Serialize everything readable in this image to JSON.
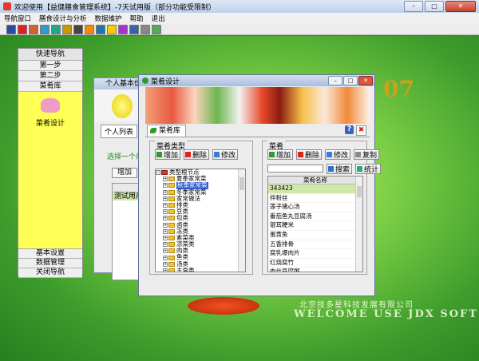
{
  "app": {
    "title": "欢迎使用【益健膳食管理系统】-7天试用版（部分功能受限制）",
    "window_buttons": [
      "–",
      "□",
      "✕"
    ]
  },
  "menu": [
    "导航窗口",
    "膳食设计与分析",
    "数据维护",
    "帮助",
    "退出"
  ],
  "toolbar_icons": [
    "exit-icon",
    "stop-icon",
    "person-icon",
    "chart-icon",
    "calendar-icon",
    "image-icon",
    "table-icon",
    "food-icon",
    "grid-icon",
    "help-icon",
    "palette-icon",
    "tools-icon",
    "doc-icon",
    "window-icon"
  ],
  "toolbar_colors": [
    "#2a4aa8",
    "#d22",
    "#c63",
    "#39c",
    "#2a8",
    "#c90",
    "#444",
    "#f80",
    "#27a",
    "#fc0",
    "#a3c",
    "#36a",
    "#888",
    "#5a5"
  ],
  "background": {
    "banner_number": "07",
    "company": "北京技多星科技发展有限公司",
    "company_en": "WELCOME USE JDX SOFT"
  },
  "nav": {
    "header": "快速导航",
    "items": [
      "第一步",
      "第二步",
      "菜肴库"
    ],
    "panel_label": "菜肴设计",
    "bottom_items": [
      "基本设置",
      "数据管理",
      "关闭导航"
    ]
  },
  "personal": {
    "title": "个人基本信息",
    "tab": "个人列表",
    "hint": "选择一个用户",
    "add": "增加",
    "column": "姓",
    "row": "测试用户"
  },
  "dish_window": {
    "title": "菜肴设计",
    "tab": "菜肴库",
    "help": "?",
    "close": "✖",
    "category": {
      "title": "菜肴类型",
      "add": "增加",
      "delete": "删除",
      "edit": "修改",
      "root": "类型根节点",
      "nodes": [
        "夏季家常菜",
        "秋季家常菜",
        "冬季家常菜",
        "家常做法",
        "排类",
        "豆类",
        "包类",
        "卤类",
        "冻类",
        "素菜类",
        "凉菜类",
        "肉类",
        "鱼类",
        "汤类",
        "主食类",
        "早餐2"
      ],
      "selected": "秋季家常菜"
    },
    "dishes": {
      "title": "菜肴",
      "add": "增加",
      "delete": "删除",
      "edit": "修改",
      "copy": "复制",
      "search": "搜索",
      "stats": "统计",
      "search_value": "",
      "column": "菜肴名称",
      "rows": [
        "343423",
        "拌粉丝",
        "莲子猪心汤",
        "番茄鱼丸豆腐汤",
        "银耳粳米",
        "蛋黄鱼",
        "五香排骨",
        "腐乳爆肉片",
        "红烧腐竹",
        "肉丝豆腐粥",
        "榨菜炒肉丝"
      ],
      "selected": "343423"
    }
  },
  "colors": {
    "accent_green": "#2f9a2f",
    "selection_blue": "#2f5fd3",
    "row_highlight": "#cfe8a7",
    "nav_yellow": "#ffff55"
  }
}
